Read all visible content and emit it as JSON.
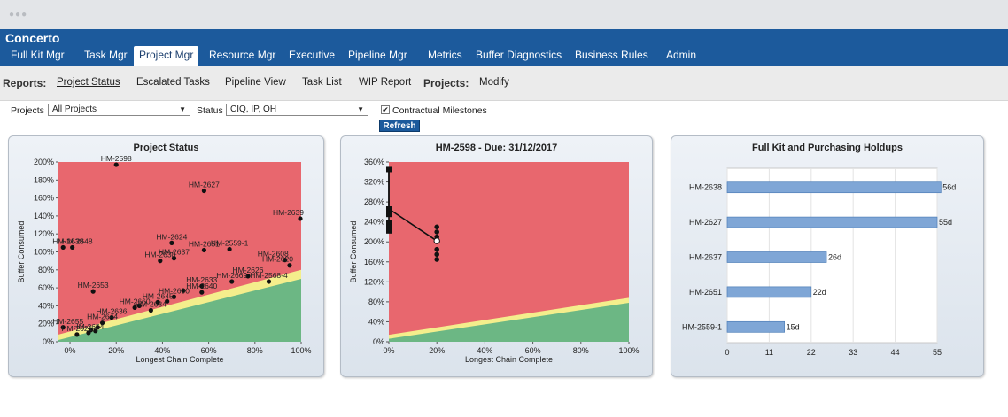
{
  "window": {
    "dots": "●●●"
  },
  "app": {
    "title": "Concerto"
  },
  "nav": {
    "tabs": [
      {
        "label": "Full Kit Mgr",
        "active": false
      },
      {
        "label": "Task Mgr",
        "active": false
      },
      {
        "label": "Project Mgr",
        "active": true
      },
      {
        "label": "Resource Mgr",
        "active": false
      },
      {
        "label": "Executive",
        "active": false
      },
      {
        "label": "Pipeline Mgr",
        "active": false
      },
      {
        "label": "Metrics",
        "active": false
      },
      {
        "label": "Buffer Diagnostics",
        "active": false
      },
      {
        "label": "Business Rules",
        "active": false
      },
      {
        "label": "Admin",
        "active": false
      }
    ]
  },
  "subnav": {
    "reports_label": "Reports:",
    "reports": [
      "Project Status",
      "Escalated Tasks",
      "Pipeline View",
      "Task List",
      "WIP Report"
    ],
    "projects_label": "Projects:",
    "modify": "Modify"
  },
  "filters": {
    "projects_label": "Projects",
    "projects_value": "All Projects",
    "status_label": "Status",
    "status_value": "CIQ, IP, OH",
    "milestones_label": "Contractual Milestones",
    "milestones_checked": true,
    "refresh_label": "Refresh"
  },
  "chart_data": [
    {
      "type": "scatter",
      "title": "Project Status",
      "xlabel": "Longest Chain Complete",
      "ylabel": "Buffer Consumed",
      "xlim": [
        -0.05,
        1.0
      ],
      "ylim": [
        0,
        2.0
      ],
      "x_ticks": [
        "0%",
        "20%",
        "40%",
        "60%",
        "80%",
        "100%"
      ],
      "y_ticks": [
        "0%",
        "20%",
        "40%",
        "60%",
        "80%",
        "100%",
        "120%",
        "140%",
        "160%",
        "180%",
        "200%"
      ],
      "zones": {
        "red": "#e8676e",
        "yellow": "#f4ee8c",
        "green": "#6cb784"
      },
      "points": [
        {
          "label": "HM-2598",
          "x": 0.2,
          "y": 1.97
        },
        {
          "label": "HM-2627",
          "x": 0.58,
          "y": 1.68
        },
        {
          "label": "HM-2639",
          "x": 1.0,
          "y": 1.37
        },
        {
          "label": "HM-2638",
          "x": -0.03,
          "y": 1.05
        },
        {
          "label": "HM-2648",
          "x": 0.01,
          "y": 1.05
        },
        {
          "label": "HM-2624",
          "x": 0.44,
          "y": 1.1
        },
        {
          "label": "HM-2651",
          "x": 0.58,
          "y": 1.02
        },
        {
          "label": "HM-2559-1",
          "x": 0.69,
          "y": 1.03
        },
        {
          "label": "HM-2637",
          "x": 0.45,
          "y": 0.93
        },
        {
          "label": "HM-2630",
          "x": 0.39,
          "y": 0.9
        },
        {
          "label": "HM-2608",
          "x": 0.93,
          "y": 0.91
        },
        {
          "label": "HM-2620",
          "x": 0.95,
          "y": 0.85
        },
        {
          "label": "HM-2626",
          "x": 0.77,
          "y": 0.73
        },
        {
          "label": "HM-2669",
          "x": 0.7,
          "y": 0.67
        },
        {
          "label": "HM-2568-4",
          "x": 0.86,
          "y": 0.67
        },
        {
          "label": "HM-2633",
          "x": 0.57,
          "y": 0.62
        },
        {
          "label": "HM-2653",
          "x": 0.1,
          "y": 0.56
        },
        {
          "label": "HM-2640",
          "x": 0.57,
          "y": 0.55
        },
        {
          "label": "HM-2600",
          "x": 0.45,
          "y": 0.5
        },
        {
          "label": "HM-2645",
          "x": 0.38,
          "y": 0.44
        },
        {
          "label": "HM-2660",
          "x": 0.28,
          "y": 0.38
        },
        {
          "label": "HM-2634",
          "x": 0.35,
          "y": 0.35
        },
        {
          "label": "HM-2636",
          "x": 0.18,
          "y": 0.27
        },
        {
          "label": "HM-2644",
          "x": 0.14,
          "y": 0.21
        },
        {
          "label": "HM-2655",
          "x": -0.03,
          "y": 0.16
        },
        {
          "label": "HM-2654",
          "x": 0.08,
          "y": 0.1
        },
        {
          "label": "HM-2621",
          "x": 0.03,
          "y": 0.08
        }
      ],
      "extra_points": [
        [
          0.11,
          0.12
        ],
        [
          0.12,
          0.16
        ],
        [
          0.09,
          0.13
        ],
        [
          0.3,
          0.4
        ],
        [
          0.42,
          0.45
        ],
        [
          0.49,
          0.57
        ]
      ]
    },
    {
      "type": "line",
      "title": "HM-2598 - Due: 31/12/2017",
      "xlabel": "Longest Chain Complete",
      "ylabel": "Buffer Consumed",
      "xlim": [
        0,
        1.0
      ],
      "ylim": [
        0,
        3.6
      ],
      "x_ticks": [
        "0%",
        "20%",
        "40%",
        "60%",
        "80%",
        "100%"
      ],
      "y_ticks": [
        "0%",
        "40%",
        "80%",
        "120%",
        "160%",
        "200%",
        "240%",
        "280%",
        "320%",
        "360%"
      ],
      "squares": [
        [
          0,
          3.45
        ],
        [
          0,
          2.66
        ],
        [
          0,
          2.55
        ],
        [
          0,
          2.38
        ],
        [
          0,
          2.3
        ],
        [
          0,
          2.22
        ]
      ],
      "circles": [
        [
          0.2,
          2.3
        ],
        [
          0.2,
          2.2
        ],
        [
          0.2,
          2.1
        ],
        [
          0.2,
          1.85
        ],
        [
          0.2,
          1.75
        ],
        [
          0.2,
          1.65
        ]
      ],
      "line": [
        [
          0,
          3.45
        ],
        [
          0,
          2.66
        ],
        [
          0.2,
          2.02
        ]
      ],
      "current": [
        0.2,
        2.02
      ]
    },
    {
      "type": "bar",
      "title": "Full Kit and Purchasing Holdups",
      "categories": [
        "HM-2638",
        "HM-2627",
        "HM-2637",
        "HM-2651",
        "HM-2559-1"
      ],
      "values": [
        56,
        55,
        26,
        22,
        15
      ],
      "data_labels": [
        "56d",
        "55d",
        "26d",
        "22d",
        "15d"
      ],
      "xlim": [
        0,
        55
      ],
      "x_ticks": [
        "0",
        "11",
        "22",
        "33",
        "44",
        "55"
      ],
      "bar_color": "#7fa6d6"
    }
  ]
}
